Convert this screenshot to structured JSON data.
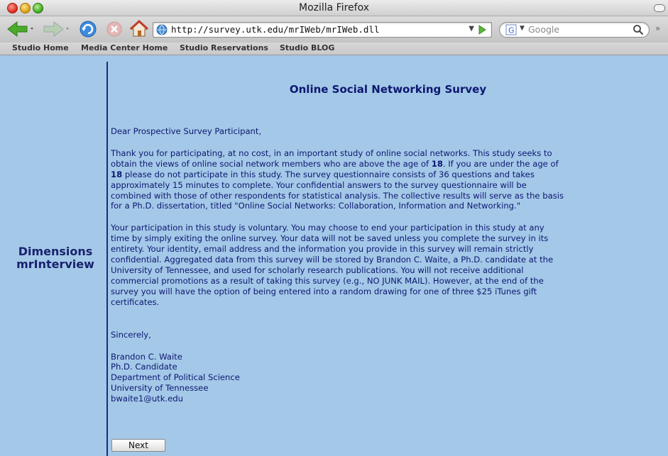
{
  "window": {
    "title": "Mozilla Firefox"
  },
  "toolbar": {
    "url": "http://survey.utk.edu/mrIWeb/mrIWeb.dll",
    "search_placeholder": "Google"
  },
  "bookmarks": [
    "Studio Home",
    "Media Center Home",
    "Studio Reservations",
    "Studio BLOG"
  ],
  "sidebar": {
    "brand_line1": "Dimensions",
    "brand_line2": "mrInterview"
  },
  "survey": {
    "title": "Online Social Networking Survey",
    "salutation": "Dear Prospective Survey Participant,",
    "para1": {
      "l1": "Thank you for participating, at no cost, in an important study of online social networks. This study seeks to",
      "l2a": "obtain the views of online social network members who are above the age of ",
      "age": "18",
      "l2b": ". If you are under the age of",
      "l3b": " please do not participate in this study. The survey questionnaire consists of 36 questions and takes",
      "l4": "approximately 15 minutes to complete. Your confidential answers to the survey questionnaire will be",
      "l5": "combined with those of other respondents for statistical analysis. The collective results will serve as the basis",
      "l6": "for a Ph.D. dissertation, titled \"Online Social Networks: Collaboration, Information and Networking.\""
    },
    "para2": [
      "Your participation in this study is voluntary. You may choose to end your participation in this study at any",
      "time by simply exiting the online survey. Your data will not be saved unless you complete the survey in its",
      "entirety. Your identity, email address and the information you provide in this survey will remain strictly",
      "confidential. Aggregated data from this survey will be stored by Brandon C. Waite, a Ph.D. candidate at the",
      "University of Tennessee, and used for scholarly research publications. You will not receive additional",
      "commercial promotions as a result of taking this survey (e.g., NO JUNK MAIL). However, at the end of the",
      "survey you will have the option of being entered into a random drawing for one of three $25 iTunes gift",
      "certificates."
    ],
    "closing": "Sincerely,",
    "signature": [
      "Brandon C. Waite",
      "Ph.D. Candidate",
      "Department of Political Science",
      "University of Tennessee",
      "bwaite1@utk.edu"
    ],
    "next_label": "Next"
  },
  "colors": {
    "page_bg": "#a4c8e8",
    "text": "#0c1870",
    "rule": "#1b2a78"
  },
  "icons": [
    "back-arrow-icon",
    "forward-arrow-icon",
    "reload-icon",
    "stop-icon",
    "home-icon",
    "globe-icon",
    "go-arrow-icon",
    "google-engine-icon",
    "search-icon"
  ]
}
